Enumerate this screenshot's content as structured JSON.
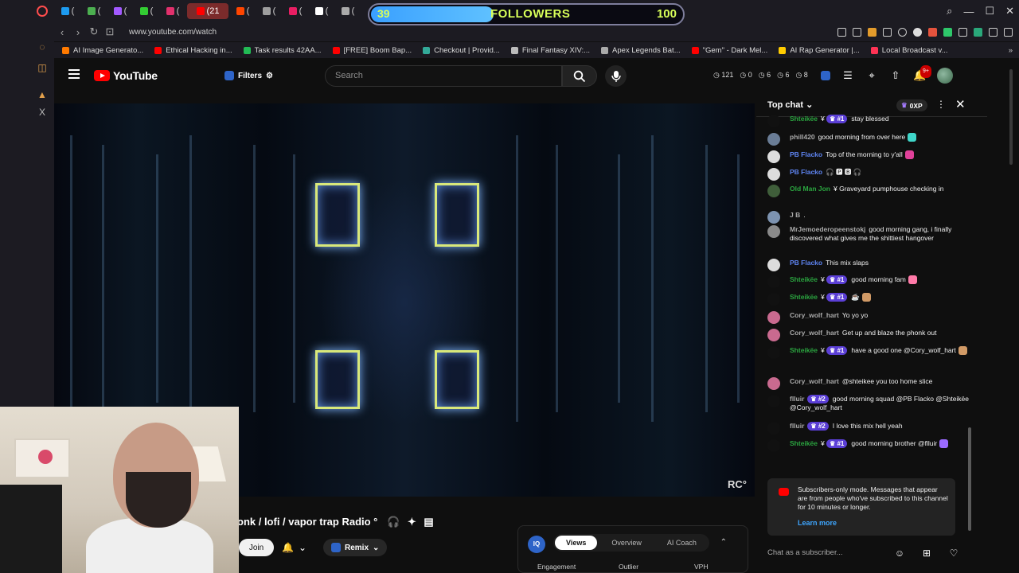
{
  "browser": {
    "tabs": [
      {
        "label": "(",
        "color": "#1d9bf0"
      },
      {
        "label": "(",
        "color": "#4caf50"
      },
      {
        "label": "(",
        "color": "#a259ff"
      },
      {
        "label": "(",
        "color": "#33cc33"
      },
      {
        "label": "(",
        "color": "#e1306c"
      },
      {
        "label": "(21",
        "color": "#ff0000",
        "active": true
      },
      {
        "label": "(",
        "color": "#ff4500"
      },
      {
        "label": "(",
        "color": "#9e9e9e"
      },
      {
        "label": "(",
        "color": "#e91e63"
      },
      {
        "label": "(",
        "color": "#ffffff"
      },
      {
        "label": "(",
        "color": "#aaaaaa"
      }
    ],
    "tabs_right": [
      {
        "label": "(",
        "color": "#2979ff"
      },
      {
        "label": "(",
        "color": "#9e9e9e"
      },
      {
        "label": "(",
        "color": "#ffffff"
      },
      {
        "label": "(",
        "color": "#ffffff"
      },
      {
        "label": "(",
        "color": "#9e9e9e"
      },
      {
        "label": "(",
        "color": "#ffffff"
      },
      {
        "label": "(",
        "color": "#9c27b0"
      },
      {
        "label": "(",
        "color": "#2979ff"
      }
    ],
    "followers_widget": {
      "left_count": "39",
      "label": "FOLLOWERS",
      "right_count": "100",
      "progress": 0.39
    },
    "url": "www.youtube.com/watch",
    "bookmarks": [
      {
        "label": "AI Image Generato...",
        "color": "#ff7a00"
      },
      {
        "label": "Ethical Hacking in...",
        "color": "#ff0000"
      },
      {
        "label": "Task results 42AA...",
        "color": "#22bb55"
      },
      {
        "label": "[FREE] Boom Bap...",
        "color": "#ff0000"
      },
      {
        "label": "Checkout | Provid...",
        "color": "#33aa99"
      },
      {
        "label": "Final Fantasy XIV:...",
        "color": "#bbbbbb"
      },
      {
        "label": "Apex Legends Bat...",
        "color": "#aaaaaa"
      },
      {
        "label": "\"Gem\" - Dark Mel...",
        "color": "#ff0000"
      },
      {
        "label": "AI Rap Generator |...",
        "color": "#ffcc00"
      },
      {
        "label": "Local Broadcast v...",
        "color": "#ff3355"
      }
    ]
  },
  "youtube": {
    "logo_text": "YouTube",
    "filters_label": "Filters",
    "search_placeholder": "Search",
    "stats": [
      "121",
      "0",
      "6",
      "6",
      "8"
    ],
    "notification_count": "9+",
    "player": {
      "watermark": "RC°"
    },
    "video_title": "onk / lofi / vapor trap Radio °",
    "join_label": "Join",
    "remix_label": "Remix",
    "analytics": {
      "logo": "IQ",
      "tabs": [
        "Views",
        "Overview",
        "AI Coach"
      ],
      "active_tab": "Views",
      "sub_labels": [
        "Engagement",
        "Outlier",
        "VPH"
      ]
    }
  },
  "chat": {
    "title": "Top chat",
    "points": "0XP",
    "messages": [
      {
        "name": "Shteikëe",
        "name_color": "#2ba640",
        "mod": true,
        "rank": "#1",
        "text": "stay blessed",
        "avatar": "#111111"
      },
      {
        "name": "phill420",
        "name_color": "#aaaaaa",
        "mod": false,
        "rank": "",
        "text": "good morning from over here",
        "avatar": "#6a7d96",
        "emoji_color": "#3fd6c9"
      },
      {
        "name": "PB Flacko",
        "name_color": "#5e84f1",
        "mod": false,
        "rank": "",
        "text": "Top of the morning to y'all",
        "avatar": "#dddddd",
        "emoji_color": "#e0419a"
      },
      {
        "name": "PB Flacko",
        "name_color": "#5e84f1",
        "mod": false,
        "rank": "",
        "text": "🎧 🅿 🅱 🎧",
        "avatar": "#dddddd"
      },
      {
        "name": "Old Man Jon",
        "name_color": "#2ba640",
        "mod": true,
        "rank": "",
        "text": "Graveyard pumphouse checking in",
        "avatar": "#3f5e3a"
      },
      {
        "name": "J B",
        "name_color": "#aaaaaa",
        "mod": false,
        "rank": "",
        "text": ".",
        "avatar": "#7d93b0"
      },
      {
        "name": "MrJemoederopeenstokj",
        "name_color": "#aaaaaa",
        "mod": false,
        "rank": "",
        "text": "good morning gang, i finally discovered what gives me the shittiest hangover",
        "avatar": "#8a8a8a"
      },
      {
        "name": "PB Flacko",
        "name_color": "#5e84f1",
        "mod": false,
        "rank": "",
        "text": "This mix slaps",
        "avatar": "#dddddd"
      },
      {
        "name": "Shteikëe",
        "name_color": "#2ba640",
        "mod": true,
        "rank": "#1",
        "text": "good morning fam",
        "avatar": "#111111",
        "emoji_color": "#ff7aa8"
      },
      {
        "name": "Shteikëe",
        "name_color": "#2ba640",
        "mod": true,
        "rank": "#1",
        "text": "☕",
        "avatar": "#111111",
        "emoji_color": "#d19a66"
      },
      {
        "name": "Cory_wolf_hart",
        "name_color": "#aaaaaa",
        "mod": false,
        "rank": "",
        "text": "Yo yo yo",
        "avatar": "#c96a8f"
      },
      {
        "name": "Cory_wolf_hart",
        "name_color": "#aaaaaa",
        "mod": false,
        "rank": "",
        "text": "Get up and blaze the phonk out",
        "avatar": "#c96a8f"
      },
      {
        "name": "Shteikëe",
        "name_color": "#2ba640",
        "mod": true,
        "rank": "#1",
        "text": "have a good one @Cory_wolf_hart",
        "avatar": "#111111",
        "emoji_color": "#d19a66"
      },
      {
        "name": "Cory_wolf_hart",
        "name_color": "#aaaaaa",
        "mod": false,
        "rank": "",
        "text": "@shteikee you too home slice",
        "avatar": "#c96a8f"
      },
      {
        "name": "flluir",
        "name_color": "#aaaaaa",
        "mod": false,
        "rank": "#2",
        "text": "good morning squad @PB Flacko @Shteikëe @Cory_wolf_hart",
        "avatar": "#111111"
      },
      {
        "name": "flluir",
        "name_color": "#aaaaaa",
        "mod": false,
        "rank": "#2",
        "text": "I love this mix hell yeah",
        "avatar": "#111111"
      },
      {
        "name": "Shteikëe",
        "name_color": "#2ba640",
        "mod": true,
        "rank": "#1",
        "text": "good morning brother @flluir",
        "avatar": "#111111",
        "emoji_color": "#9b6bff"
      }
    ],
    "notice": {
      "text": "Subscribers-only mode. Messages that appear are from people who've subscribed to this channel for 10 minutes or longer.",
      "link": "Learn more"
    },
    "input_placeholder": "Chat as a subscriber..."
  }
}
